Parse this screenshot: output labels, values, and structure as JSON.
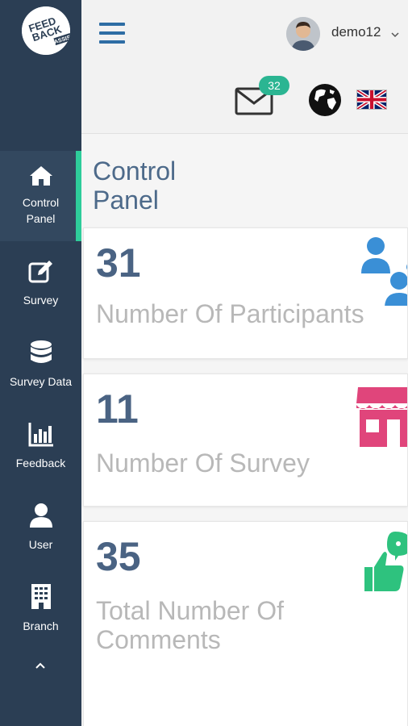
{
  "logo": {
    "text_lines": [
      "FEED",
      "BACK",
      "ASSIST"
    ]
  },
  "sidebar": {
    "items": [
      {
        "label_lines": [
          "Control",
          "Panel"
        ],
        "icon": "home-icon",
        "active": true
      },
      {
        "label": "Survey",
        "icon": "edit-icon"
      },
      {
        "label": "Survey Data",
        "icon": "database-icon"
      },
      {
        "label": "Feedback",
        "icon": "bar-chart-icon"
      },
      {
        "label": "User",
        "icon": "user-icon"
      },
      {
        "label": "Branch",
        "icon": "building-icon"
      }
    ],
    "collapse_icon": "chevron-up-icon"
  },
  "header": {
    "menu_icon": "hamburger-icon",
    "username": "demo12",
    "notifications_count": "32",
    "language_icon": "globe-icon",
    "language_flag": "uk-flag-icon"
  },
  "page": {
    "title_lines": [
      "Control",
      "Panel"
    ]
  },
  "cards": [
    {
      "value": "31",
      "label": "Number Of Participants",
      "icon": "participants-icon",
      "color": "#3a8fd6"
    },
    {
      "value": "11",
      "label": "Number Of Survey",
      "icon": "store-icon",
      "color": "#e0457b"
    },
    {
      "value": "35",
      "label_lines": [
        "Total Number Of",
        "Comments"
      ],
      "icon": "thumbs-up-comment-icon",
      "color": "#2ec27e"
    }
  ],
  "colors": {
    "sidebar_bg": "#2b3e54",
    "accent": "#2ecc9a",
    "title": "#4d6a8a"
  }
}
